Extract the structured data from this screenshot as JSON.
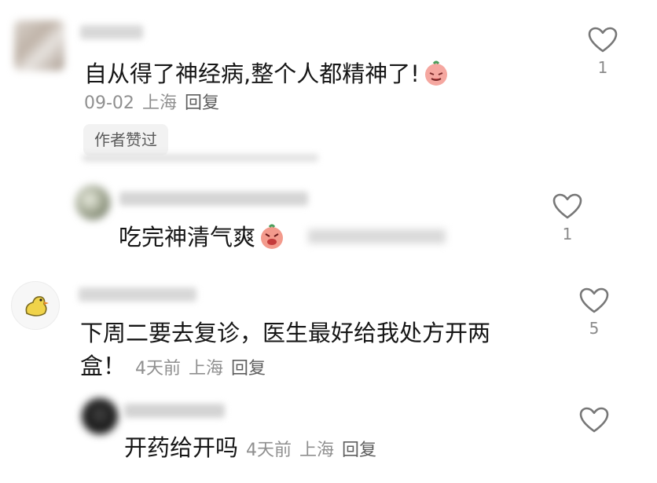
{
  "comments": [
    {
      "text": "自从得了神经病,整个人都精神了!",
      "date": "09-02",
      "location": "上海",
      "reply_label": "回复",
      "badge": "作者赞过",
      "likes": "1",
      "replies": [
        {
          "text": "吃完神清气爽",
          "likes": "1"
        }
      ]
    },
    {
      "text_line1": "下周二要去复诊，医生最好给我处方开两",
      "text_line2": "盒！",
      "date": "4天前",
      "location": "上海",
      "reply_label": "回复",
      "likes": "5",
      "replies": [
        {
          "text": "开药给开吗",
          "date": "4天前",
          "location": "上海",
          "reply_label": "回复",
          "likes": ""
        }
      ]
    }
  ],
  "colors": {
    "text": "#161616",
    "meta": "#8f8f8f",
    "badge_bg": "#f2f2f2",
    "icon": "#777777"
  },
  "icons": {
    "like": "heart-outline-icon",
    "emoji": "sticker-emoji-icon"
  }
}
